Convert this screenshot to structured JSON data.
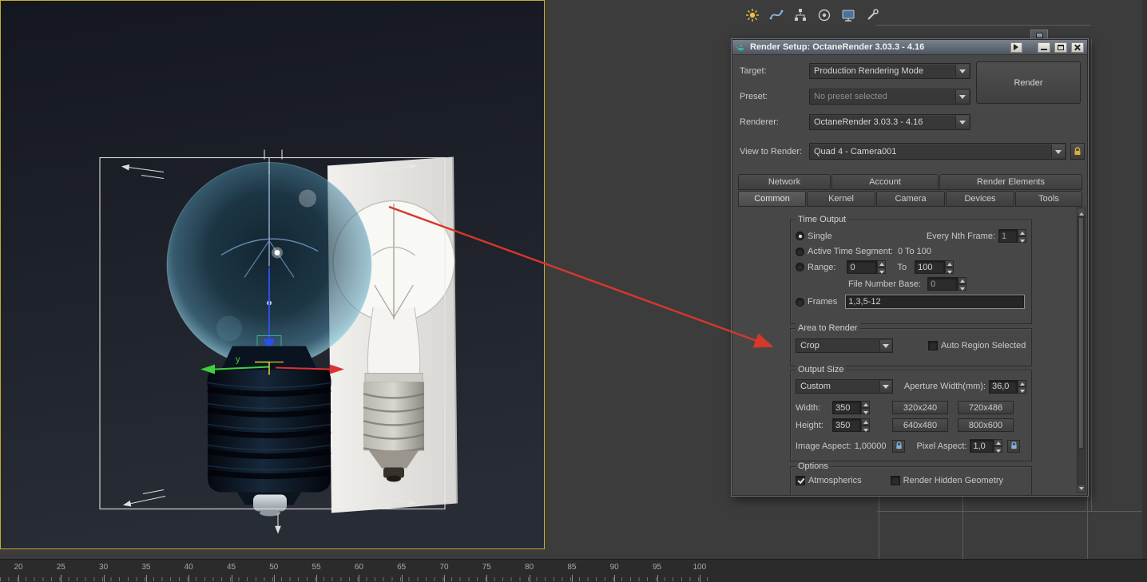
{
  "window": {
    "title": "Render Setup: OctaneRender 3.03.3 - 4.16",
    "controls": [
      "rollup",
      "minimize",
      "maximize",
      "close"
    ]
  },
  "toolbar": {
    "icons": [
      "lights",
      "shapes",
      "hierarchy",
      "space-warps",
      "display",
      "utilities"
    ]
  },
  "dialog": {
    "target_label": "Target:",
    "target_value": "Production Rendering Mode",
    "render_button": "Render",
    "preset_label": "Preset:",
    "preset_value": "No preset selected",
    "renderer_label": "Renderer:",
    "renderer_value": "OctaneRender 3.03.3 - 4.16",
    "view_label": "View to Render:",
    "view_value": "Quad 4 - Camera001",
    "tabs_row1": [
      "Network",
      "Account",
      "Render Elements"
    ],
    "tabs_row2": [
      "Common",
      "Kernel",
      "Camera",
      "Devices",
      "Tools"
    ],
    "active_tab": "Common",
    "time_output": {
      "group_title": "Time Output",
      "single_label": "Single",
      "every_nth_label": "Every Nth Frame:",
      "every_nth_value": "1",
      "active_segment_label": "Active Time Segment:",
      "active_segment_range": "0 To 100",
      "range_label": "Range:",
      "range_from": "0",
      "range_to_label": "To",
      "range_to": "100",
      "file_number_label": "File Number Base:",
      "file_number_value": "0",
      "frames_label": "Frames",
      "frames_value": "1,3,5-12"
    },
    "area_to_render": {
      "group_title": "Area to Render",
      "mode_value": "Crop",
      "auto_region_label": "Auto Region Selected"
    },
    "output_size": {
      "group_title": "Output Size",
      "preset_value": "Custom",
      "aperture_label": "Aperture Width(mm):",
      "aperture_value": "36,0",
      "width_label": "Width:",
      "width_value": "350",
      "height_label": "Height:",
      "height_value": "350",
      "btn_320": "320x240",
      "btn_720": "720x486",
      "btn_640": "640x480",
      "btn_800": "800x600",
      "image_aspect_label": "Image Aspect:",
      "image_aspect_value": "1,00000",
      "pixel_aspect_label": "Pixel Aspect:",
      "pixel_aspect_value": "1,0"
    },
    "options": {
      "group_title": "Options",
      "atmospherics_label": "Atmospherics",
      "render_hidden_label": "Render Hidden Geometry"
    }
  },
  "viewport": {
    "axis_label": "y"
  },
  "timeline": {
    "ticks": [
      "20",
      "25",
      "30",
      "35",
      "40",
      "45",
      "50",
      "55",
      "60",
      "65",
      "70",
      "75",
      "80",
      "85",
      "90",
      "95",
      "100"
    ]
  },
  "colors": {
    "viewport_border": "#c7ab2f",
    "annotation_arrow": "#d6382a",
    "glass_tint": "#4b89a6"
  }
}
